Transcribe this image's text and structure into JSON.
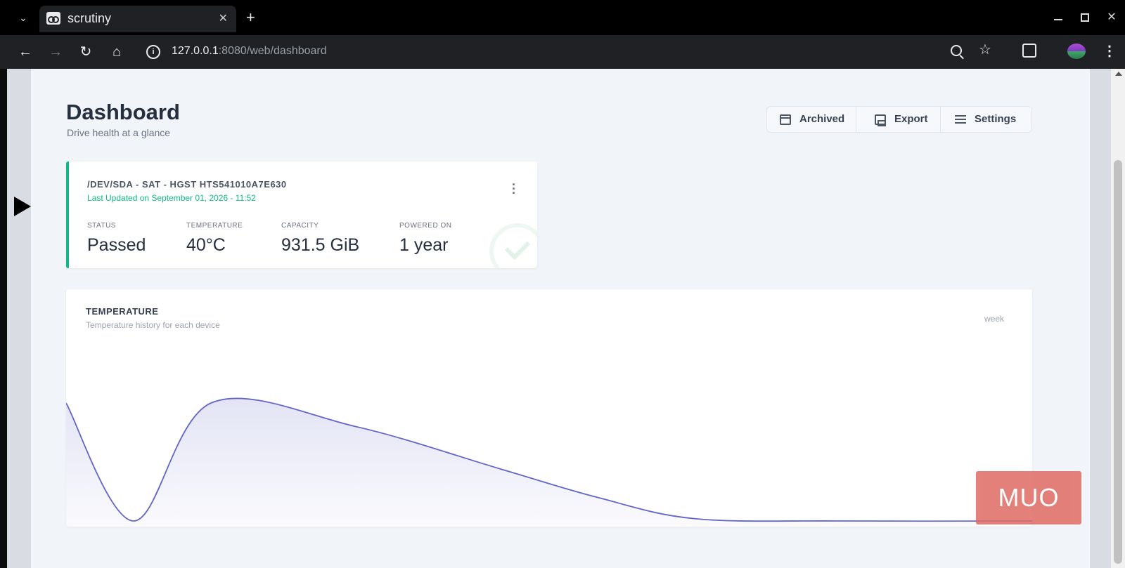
{
  "browser": {
    "tab_title": "scrutiny",
    "url_host": "127.0.0.1",
    "url_rest": ":8080/web/dashboard",
    "new_tab": "+",
    "close_tab": "✕"
  },
  "header": {
    "title": "Dashboard",
    "subtitle": "Drive health at a glance",
    "buttons": {
      "archived": "Archived",
      "export": "Export",
      "settings": "Settings"
    }
  },
  "device": {
    "name": "/DEV/SDA - SAT - HGST HTS541010A7E630",
    "updated": "Last Updated on September 01, 2026 - 11:52",
    "accent_color": "#10b981",
    "stats": [
      {
        "label": "STATUS",
        "value": "Passed"
      },
      {
        "label": "TEMPERATURE",
        "value": "40°C"
      },
      {
        "label": "CAPACITY",
        "value": "931.5 GiB"
      },
      {
        "label": "POWERED ON",
        "value": "1 year"
      }
    ]
  },
  "temperature": {
    "title": "TEMPERATURE",
    "subtitle": "Temperature history for each device",
    "range": "week",
    "line_color": "#6366c8"
  },
  "chart_data": {
    "type": "area",
    "x": [
      0,
      0.07,
      0.15,
      0.3,
      0.45,
      0.55,
      0.65,
      0.8,
      1.0
    ],
    "values": [
      0.5,
      0.0,
      0.5,
      0.4,
      0.22,
      0.1,
      0.01,
      0.0,
      0.0
    ],
    "title": "TEMPERATURE",
    "xlabel": "",
    "ylabel": "",
    "grid": false
  },
  "watermark": "MUO"
}
